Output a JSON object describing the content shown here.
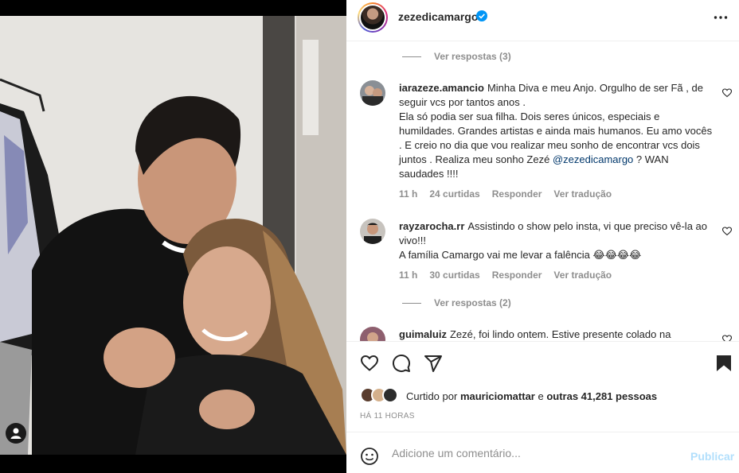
{
  "post": {
    "username": "zezedicamargo",
    "verified": true,
    "more_icon": "more-horizontal-icon"
  },
  "comments": {
    "replies_top": "Ver respostas (3)",
    "items": [
      {
        "username": "iarazeze.amancio",
        "text": "Minha Diva e meu Anjo. Orgulho de ser Fã , de seguir vcs por tantos anos .\nEla só podia ser sua filha. Dois seres únicos, especiais e humildades. Grandes artistas e ainda mais humanos. Eu amo vocês . E creio no dia que vou realizar meu sonho de encontrar vcs dois juntos . Realiza meu sonho Zezé ",
        "mention": "@zezedicamargo",
        "text_after": " ? WAN saudades !!!!",
        "time": "11 h",
        "likes": "24 curtidas",
        "reply": "Responder",
        "translate": "Ver tradução"
      },
      {
        "username": "rayzarocha.rr",
        "text": "Assistindo o show pelo insta, vi que preciso vê-la ao vivo!!!\nA família Camargo vai me levar a falência ",
        "emoji": "😂😂😂😂",
        "time": "11 h",
        "likes": "30 curtidas",
        "reply": "Responder",
        "translate": "Ver tradução"
      }
    ],
    "replies_bottom": "Ver respostas (2)",
    "partial": {
      "username": "guimaluiz",
      "text": "Zezé, foi lindo ontem. Estive presente colado na"
    }
  },
  "actions": {
    "like_icon": "heart-icon",
    "comment_icon": "comment-icon",
    "share_icon": "send-icon",
    "save_icon": "bookmark-icon"
  },
  "likes": {
    "prefix": "Curtido por",
    "user": "mauriciomattar",
    "connector": "e",
    "others": "outras 41,281 pessoas"
  },
  "time_ago": "HÁ 11 HORAS",
  "add_comment": {
    "placeholder": "Adicione um comentário...",
    "publish": "Publicar"
  },
  "colors": {
    "verified": "#0095f6",
    "publish_disabled": "#b2dffc",
    "muted": "#8e8e8e",
    "mention": "#00376b"
  }
}
